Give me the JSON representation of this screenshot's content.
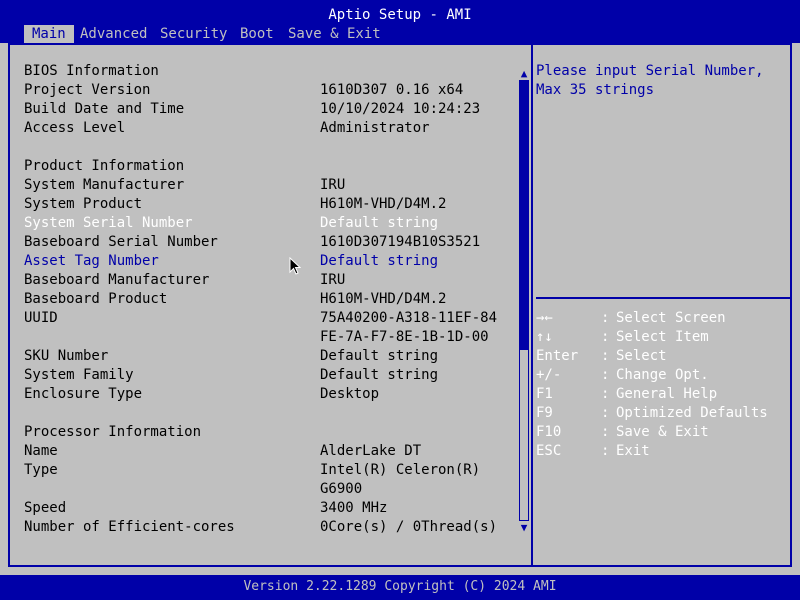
{
  "title": "Aptio Setup - AMI",
  "tabs": [
    {
      "label": "Main"
    },
    {
      "label": "Advanced"
    },
    {
      "label": "Security"
    },
    {
      "label": "Boot"
    },
    {
      "label": "Save & Exit"
    }
  ],
  "rows": [
    {
      "label": "BIOS Information",
      "value": ""
    },
    {
      "label": "Project Version",
      "value": "1610D307 0.16 x64"
    },
    {
      "label": "Build Date and Time",
      "value": "10/10/2024 10:24:23"
    },
    {
      "label": "Access Level",
      "value": "Administrator"
    },
    {
      "label": "Product Information",
      "value": ""
    },
    {
      "label": "System Manufacturer",
      "value": "IRU"
    },
    {
      "label": "System Product",
      "value": "H610M-VHD/D4M.2"
    },
    {
      "label": "System Serial Number",
      "value": "Default string"
    },
    {
      "label": "Baseboard Serial Number",
      "value": "1610D307194B10S3521"
    },
    {
      "label": "Asset Tag Number",
      "value": "Default string"
    },
    {
      "label": "Baseboard Manufacturer",
      "value": "IRU"
    },
    {
      "label": "Baseboard Product",
      "value": "H610M-VHD/D4M.2"
    },
    {
      "label": "UUID",
      "value": "75A40200-A318-11EF-84"
    },
    {
      "label": "",
      "value": "FE-7A-F7-8E-1B-1D-00"
    },
    {
      "label": "SKU Number",
      "value": "Default string"
    },
    {
      "label": "System Family",
      "value": "Default string"
    },
    {
      "label": "Enclosure Type",
      "value": "Desktop"
    },
    {
      "label": "Processor Information",
      "value": ""
    },
    {
      "label": "Name",
      "value": "AlderLake DT"
    },
    {
      "label": "Type",
      "value": "Intel(R) Celeron(R)"
    },
    {
      "label": "",
      "value": "G6900"
    },
    {
      "label": "Speed",
      "value": "3400 MHz"
    },
    {
      "label": "Number of Efficient-cores",
      "value": "0Core(s) / 0Thread(s)"
    }
  ],
  "help": {
    "line1": "Please input Serial Number,",
    "line2": "Max 35 strings"
  },
  "keys": [
    {
      "key": "→←",
      "sep": ":",
      "desc": "Select Screen"
    },
    {
      "key": "↑↓",
      "sep": ":",
      "desc": "Select Item"
    },
    {
      "key": "Enter",
      "sep": ":",
      "desc": "Select"
    },
    {
      "key": "+/-",
      "sep": ":",
      "desc": "Change Opt."
    },
    {
      "key": "F1",
      "sep": ":",
      "desc": "General Help"
    },
    {
      "key": "F9",
      "sep": ":",
      "desc": "Optimized Defaults"
    },
    {
      "key": "F10",
      "sep": ":",
      "desc": "Save & Exit"
    },
    {
      "key": "ESC",
      "sep": ":",
      "desc": "Exit"
    }
  ],
  "footer": "Version 2.22.1289 Copyright (C) 2024 AMI",
  "icons": {
    "scroll_up": "scroll-up-arrow-icon",
    "scroll_down": "scroll-down-arrow-icon",
    "cursor": "mouse-pointer-icon"
  },
  "colors": {
    "background": "#c0c0c0",
    "bar": "#0000a8",
    "text": "#000000",
    "highlight": "#ffffff"
  }
}
